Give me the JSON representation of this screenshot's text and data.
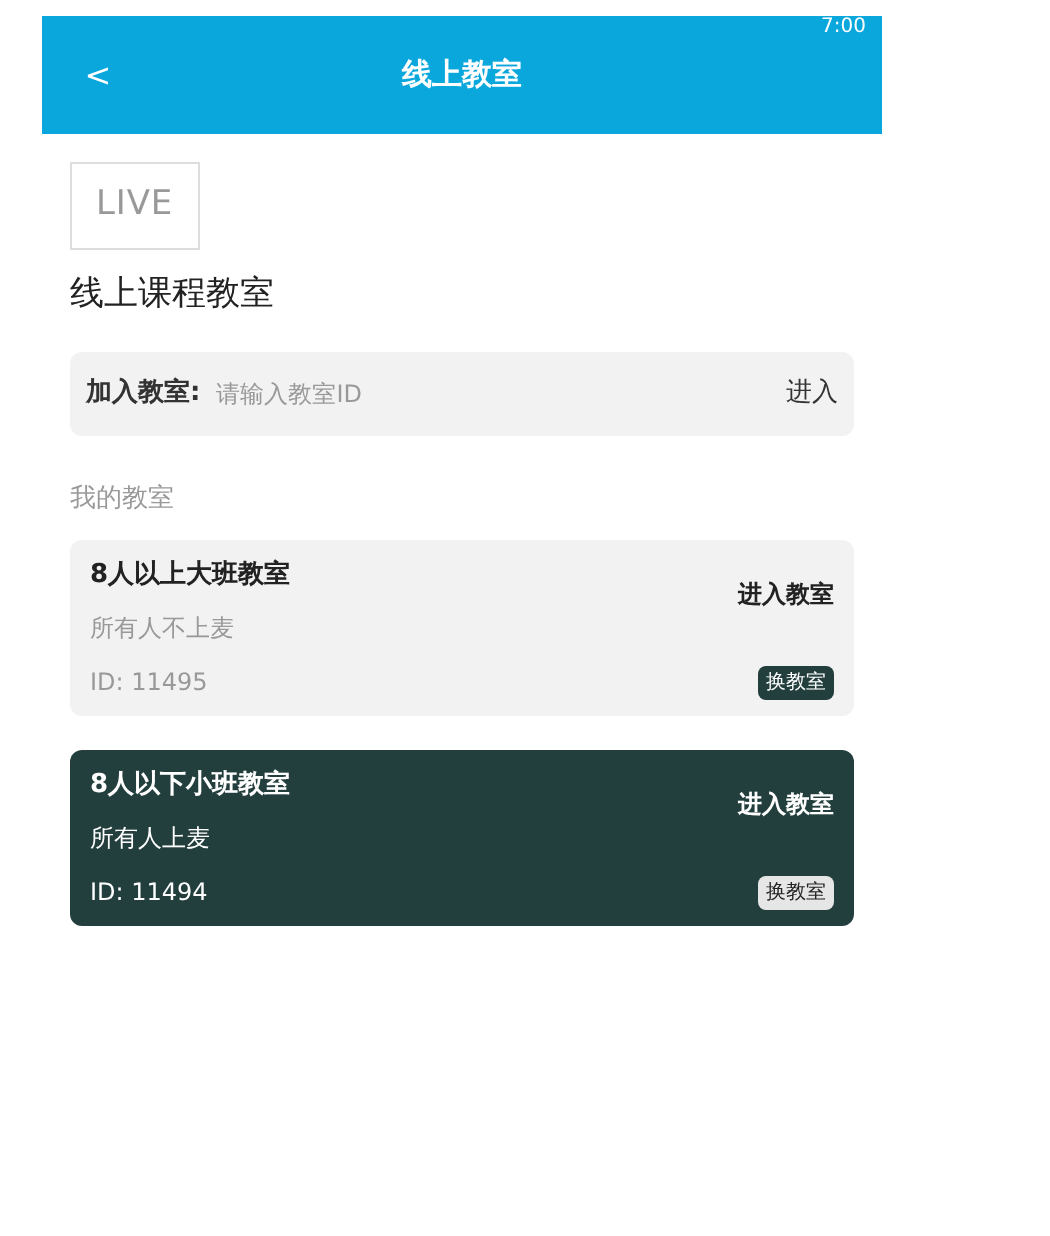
{
  "status_bar": {
    "time": "7:00"
  },
  "header": {
    "back": "<",
    "title": "线上教室"
  },
  "logo": "LIVE",
  "page_title": "线上课程教室",
  "join": {
    "label": "加入教室:",
    "placeholder": "请输入教室ID",
    "button": "进入"
  },
  "section_title": "我的教室",
  "classrooms": [
    {
      "name": "8人以上大班教室",
      "note": "所有人不上麦",
      "id": "ID: 11495",
      "enter": "进入教室",
      "switch": "换教室",
      "selected": false
    },
    {
      "name": "8人以下小班教室",
      "note": "所有人上麦",
      "id": "ID: 11494",
      "enter": "进入教室",
      "switch": "换教室",
      "selected": true
    }
  ]
}
